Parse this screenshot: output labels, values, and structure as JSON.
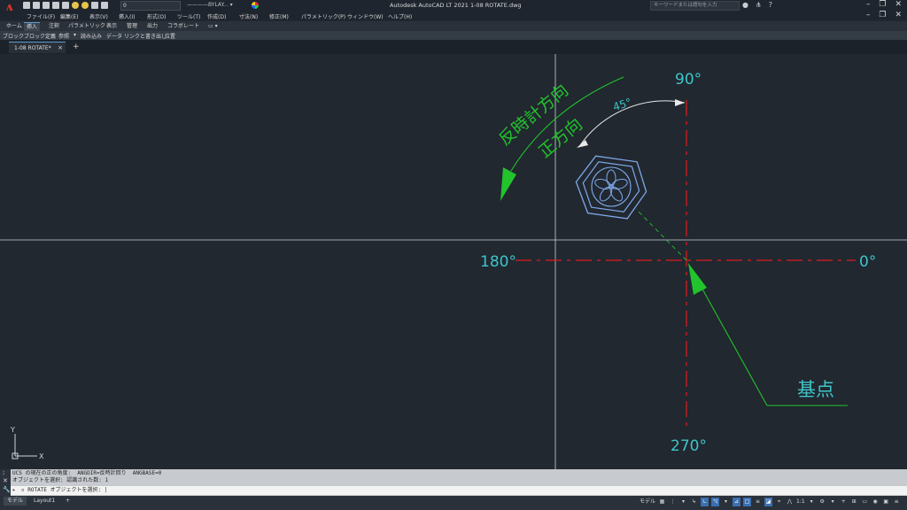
{
  "app": {
    "title": "Autodesk AutoCAD LT 2021    1-08 ROTATE.dwg",
    "logo_letter": "A",
    "layer_value": "0",
    "linetype_value": "BYLAY...",
    "search_placeholder": "キーワードまたは語句を入力"
  },
  "menu": [
    "ファイル(F)",
    "編集(E)",
    "表示(V)",
    "挿入(I)",
    "形式(O)",
    "ツール(T)",
    "作成(D)",
    "寸法(N)",
    "修正(M)",
    "パラメトリック(P)",
    "ウィンドウ(W)",
    "ヘルプ(H)"
  ],
  "ribbon_tabs": [
    "ホーム",
    "挿入",
    "注釈",
    "パラメトリック",
    "表示",
    "管理",
    "出力",
    "コラボレート"
  ],
  "ribbon_active": "挿入",
  "panels": [
    "ブロック",
    "ブロック定義",
    "参照",
    "読み込み",
    "データ",
    "リンクと書き出し",
    "位置"
  ],
  "doc_tab": {
    "label": "1-08 ROTATE*",
    "close": "×",
    "new": "+"
  },
  "drawing": {
    "angle_90": "90°",
    "angle_180": "180°",
    "angle_0": "0°",
    "angle_270": "270°",
    "angle_45": "45°",
    "ccw_text": "反時計方向",
    "positive_text": "正方向",
    "base_point_text": "基点",
    "ucs_y": "Y",
    "ucs_x": "X"
  },
  "command": {
    "history": [
      "UCS の現在の正の角度:  ANGDIR=反時計回り  ANGBASE=0",
      "オブジェクトを選択: 認識された数: 1"
    ],
    "prompt": "ROTATE オブジェクトを選択:"
  },
  "layout_tabs": [
    "モデル",
    "Layout1"
  ],
  "layout_add": "+",
  "status": {
    "model": "モデル",
    "scale": "1:1"
  },
  "colors": {
    "background": "#212830",
    "center_lines": "#e01c1c",
    "annotation": "#3ec5c9",
    "leader": "#22c32c",
    "object": "#7fa8e8"
  }
}
